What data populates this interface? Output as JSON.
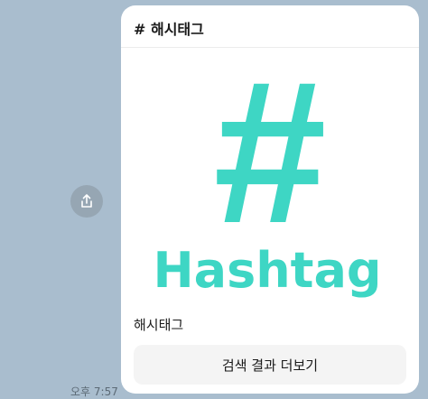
{
  "message": {
    "time": "오후 7:57",
    "share_icon": "share-icon"
  },
  "card": {
    "title": "# 해시태그",
    "image": {
      "hash_symbol": "#",
      "logo_text": "Hashtag",
      "accent_color": "#3ed6c4"
    },
    "caption": "해시태그",
    "more_button_label": "검색 결과 더보기"
  }
}
